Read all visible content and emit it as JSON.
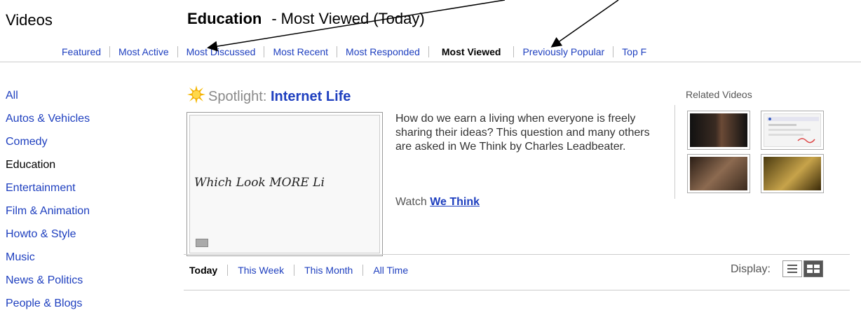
{
  "header": {
    "section_title": "Videos",
    "category": "Education",
    "separator": "-",
    "view": "Most Viewed (Today)"
  },
  "tabs": [
    {
      "label": "Featured",
      "active": false
    },
    {
      "label": "Most Active",
      "active": false
    },
    {
      "label": "Most Discussed",
      "active": false
    },
    {
      "label": "Most Recent",
      "active": false
    },
    {
      "label": "Most Responded",
      "active": false
    },
    {
      "label": "Most Viewed",
      "active": true
    },
    {
      "label": "Previously Popular",
      "active": false
    },
    {
      "label": "Top F",
      "active": false
    }
  ],
  "categories": [
    {
      "label": "All",
      "active": false
    },
    {
      "label": "Autos & Vehicles",
      "active": false
    },
    {
      "label": "Comedy",
      "active": false
    },
    {
      "label": "Education",
      "active": true
    },
    {
      "label": "Entertainment",
      "active": false
    },
    {
      "label": "Film & Animation",
      "active": false
    },
    {
      "label": "Howto & Style",
      "active": false
    },
    {
      "label": "Music",
      "active": false
    },
    {
      "label": "News & Politics",
      "active": false
    },
    {
      "label": "People & Blogs",
      "active": false
    }
  ],
  "spotlight": {
    "prefix": "Spotlight:",
    "name": "Internet Life",
    "thumb_text": "Which  Look MORE  Li",
    "description": "How do we earn a living when everyone is freely sharing their ideas? This question and many others are asked in We Think by Charles Leadbeater.",
    "watch_prefix": "Watch",
    "watch_link": "We Think"
  },
  "related": {
    "label": "Related Videos"
  },
  "time_tabs": [
    {
      "label": "Today",
      "active": true
    },
    {
      "label": "This Week",
      "active": false
    },
    {
      "label": "This Month",
      "active": false
    },
    {
      "label": "All Time",
      "active": false
    }
  ],
  "display": {
    "label": "Display:"
  },
  "icons": {
    "spotlight": "sun-icon",
    "list_view": "list-view-icon",
    "grid_view": "grid-view-icon"
  },
  "colors": {
    "link": "#1e3fbf",
    "muted": "#8a8a8a"
  }
}
